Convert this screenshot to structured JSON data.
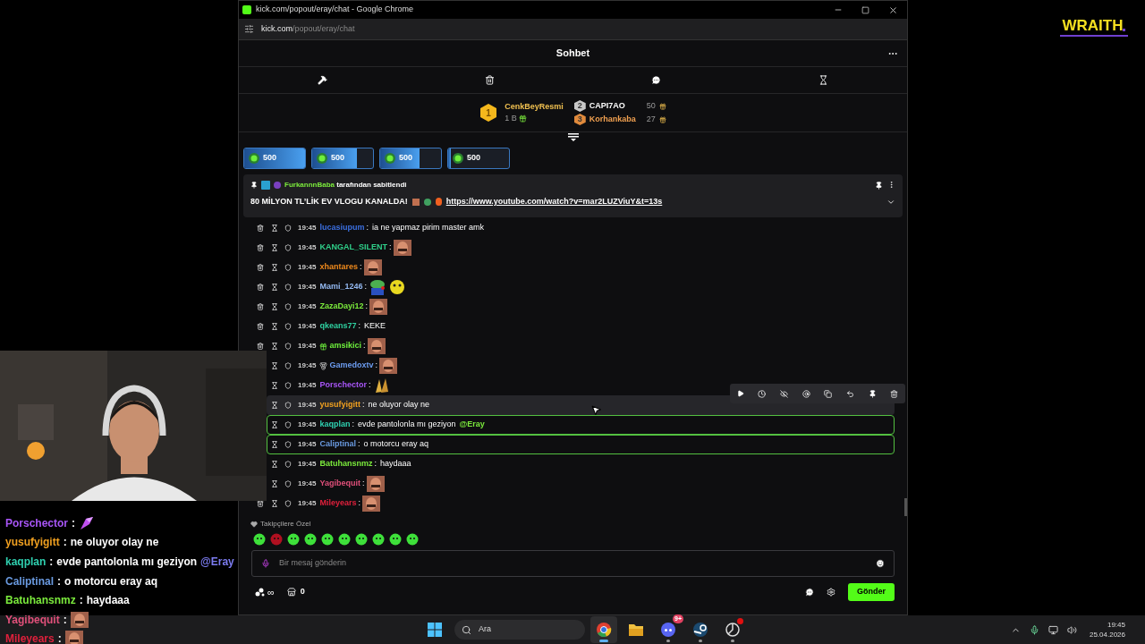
{
  "window": {
    "title": "kick.com/popout/eray/chat - Google Chrome",
    "url_host": "kick.com",
    "url_path": "/popout/eray/chat"
  },
  "chat": {
    "title": "Sohbet",
    "leaderboard": [
      {
        "rank": "1",
        "name": "CenkBeyResmi",
        "amount": "1 B",
        "color": "#f0c050"
      },
      {
        "rank": "2",
        "name": "CAPI7AO",
        "amount": "50",
        "color": "#ffffff"
      },
      {
        "rank": "3",
        "name": "Korhankaba",
        "amount": "27",
        "color": "#f0a050"
      }
    ],
    "goals": [
      {
        "amount": "500",
        "level": 1
      },
      {
        "amount": "500",
        "level": 0.74
      },
      {
        "amount": "500",
        "level": 0.65
      },
      {
        "amount": "500",
        "level": 0.05
      }
    ],
    "pinned": {
      "pinned_by": "FurkannnBaba",
      "suffix": "tarafından sabitlendi",
      "message": "80 MİLYON TL’LİK EV VLOGU KANALDA!",
      "link": "https://www.youtube.com/watch?v=mar2LUZViuY&t=13s"
    },
    "separator": ":",
    "messages": [
      {
        "time": "19:45",
        "user": "lucasiupum",
        "color": "#3b6fe0",
        "text": "ia ne yapmaz pirim master amk",
        "highlighted": false,
        "hovered": false
      },
      {
        "time": "19:45",
        "user": "KANGAL_SILENT",
        "color": "#2fd08a",
        "emotes": [
          {
            "kind": "face"
          }
        ],
        "highlighted": false,
        "hovered": false
      },
      {
        "time": "19:45",
        "user": "xhantares",
        "color": "#f08a1c",
        "emotes": [
          {
            "kind": "face"
          }
        ],
        "highlighted": false,
        "hovered": false
      },
      {
        "time": "19:45",
        "user": "Mami_1246",
        "color": "#93b8f0",
        "emotes": [
          {
            "kind": "frog"
          },
          {
            "kind": "blob"
          }
        ],
        "highlighted": false,
        "hovered": false
      },
      {
        "time": "19:45",
        "user": "ZazaDayi12",
        "color": "#7bea3c",
        "emotes": [
          {
            "kind": "face"
          }
        ],
        "highlighted": false,
        "hovered": false
      },
      {
        "time": "19:45",
        "user": "qkeans77",
        "color": "#2fd0a0",
        "text": "KEKE",
        "highlighted": false,
        "hovered": false
      },
      {
        "time": "19:45",
        "user": "amsikici",
        "color": "#6ef03c",
        "badge": {
          "kind": "gift"
        },
        "emotes": [
          {
            "kind": "face"
          }
        ],
        "highlighted": false,
        "hovered": false
      },
      {
        "time": "19:45",
        "user": "Gamedoxtv",
        "color": "#6c9cf0",
        "badge": {
          "kind": "medal"
        },
        "emotes": [
          {
            "kind": "face"
          }
        ],
        "highlighted": false,
        "hovered": false
      },
      {
        "time": "19:45",
        "user": "Porschector",
        "color": "#a855f7",
        "emotes": [
          {
            "kind": "hands"
          }
        ],
        "highlighted": false,
        "hovered": false
      },
      {
        "time": "19:45",
        "user": "yusufyigitt",
        "color": "#f0a020",
        "text": "ne oluyor olay ne",
        "highlighted": false,
        "hovered": true
      },
      {
        "time": "19:45",
        "user": "kaqplan",
        "color": "#2fd0b0",
        "text": "evde pantolonla mı geziyon",
        "mention": "@Eray",
        "highlighted": true,
        "hovered": false
      },
      {
        "time": "19:45",
        "user": "Caliptinal",
        "color": "#6a9ae0",
        "text": "o motorcu eray aq",
        "highlighted": true,
        "hovered": false
      },
      {
        "time": "19:45",
        "user": "Batuhansnmz",
        "color": "#7bea3c",
        "text": "haydaaa",
        "highlighted": false,
        "hovered": false
      },
      {
        "time": "19:45",
        "user": "Yagibequit",
        "color": "#e0507a",
        "emotes": [
          {
            "kind": "face"
          }
        ],
        "highlighted": false,
        "hovered": false
      },
      {
        "time": "19:45",
        "user": "Mileyears",
        "color": "#e0203c",
        "emotes": [
          {
            "kind": "face"
          }
        ],
        "highlighted": false,
        "hovered": false
      }
    ],
    "followers_label": "Takipçilere Özel",
    "follower_emotes": [
      {
        "color": "#3ee03a"
      },
      {
        "color": "#b01020"
      },
      {
        "color": "#3ee03a"
      },
      {
        "color": "#3ee03a"
      },
      {
        "color": "#3ee03a"
      },
      {
        "color": "#3ee03a"
      },
      {
        "color": "#3ee03a"
      },
      {
        "color": "#3ee03a"
      },
      {
        "color": "#3ee03a"
      },
      {
        "color": "#3ee03a"
      }
    ],
    "input": {
      "placeholder": "Bir mesaj gönderin"
    },
    "points": "∞",
    "drops": "0",
    "send": "Gönder"
  },
  "overlay_chat": [
    {
      "user": "Porschector",
      "color": "#a855f7",
      "emote": {
        "kind": "crystal"
      }
    },
    {
      "user": "yusufyigitt",
      "color": "#f0a020",
      "text": "ne oluyor olay ne"
    },
    {
      "user": "kaqplan",
      "color": "#2fd0b0",
      "text": "evde pantolonla mı geziyon",
      "mention": "@Eray"
    },
    {
      "user": "Caliptinal",
      "color": "#6a9ae0",
      "text": "o motorcu eray aq"
    },
    {
      "user": "Batuhansnmz",
      "color": "#7bea3c",
      "text": "haydaaa"
    },
    {
      "user": "Yagibequit",
      "color": "#e0507a",
      "emote": {
        "kind": "face"
      }
    },
    {
      "user": "Mileyears",
      "color": "#e0203c",
      "emote": {
        "kind": "face"
      }
    }
  ],
  "logo": "WRAITH",
  "taskbar": {
    "search": "Ara",
    "apps": [
      {
        "kind": "chrome",
        "active": true
      },
      {
        "kind": "folder",
        "active": false,
        "running": false
      },
      {
        "kind": "discord",
        "active": false,
        "running": true,
        "badge": "9+"
      },
      {
        "kind": "steam",
        "active": false,
        "running": true
      },
      {
        "kind": "app",
        "active": false,
        "running": true,
        "alert": true
      }
    ],
    "time": "19:45",
    "date": "25.04.2026"
  }
}
